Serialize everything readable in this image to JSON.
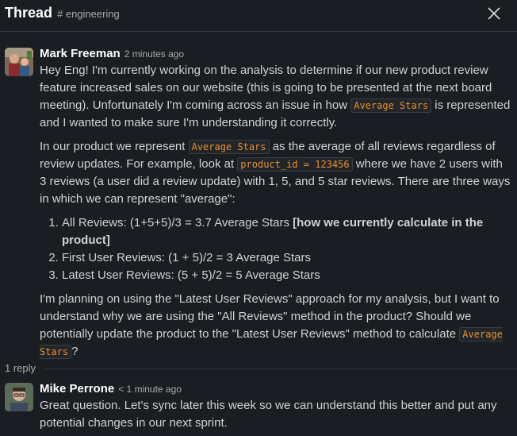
{
  "header": {
    "title": "Thread",
    "channel": "# engineering",
    "close_icon": "close-icon"
  },
  "message1": {
    "author": "Mark Freeman",
    "timestamp": "2 minutes ago",
    "p1_a": "Hey Eng! I'm currently working on the analysis to determine if our new product review feature increased sales on our website (this is going to be presented at the next board meeting). Unfortunately I'm coming across an issue in how ",
    "p1_code": "Average Stars",
    "p1_b": " is represented and I wanted to make sure I'm understanding it correctly.",
    "p2_a": "In our product we represent ",
    "p2_code1": "Average Stars",
    "p2_b": " as the average of all reviews regardless of review updates. For example, look at ",
    "p2_code2": "product_id =  123456",
    "p2_c": " where we have 2 users with 3 reviews (a user did a review update) with 1, 5, and 5 star reviews. There are three ways in which we can represent \"average\":",
    "list": [
      {
        "text": "All Reviews: (1+5+5)/3 = 3.7 Average Stars ",
        "bold": "[how we currently calculate in the product]"
      },
      {
        "text": "First User Reviews: (1 + 5)/2 = 3 Average Stars",
        "bold": ""
      },
      {
        "text": "Latest User Reviews: (5 + 5)/2 = 5 Average Stars",
        "bold": ""
      }
    ],
    "p3_a": "I'm planning on using the \"Latest User Reviews\" approach for my analysis, but I want to understand why we are using the \"All Reviews\" method in the product? Should we potentially update the product to the \"Latest User Reviews\" method to calculate ",
    "p3_code": "Average Stars",
    "p3_b": "?"
  },
  "replies": {
    "count_label": "1 reply"
  },
  "message2": {
    "author": "Mike Perrone",
    "timestamp": "< 1 minute ago",
    "text": "Great question. Let's sync later this week so we can understand this better and put any potential changes in our next sprint."
  },
  "colors": {
    "background": "#1a1d21",
    "code_text": "#e8912d",
    "author_text": "#ffffff",
    "body_text": "#d1d2d3",
    "muted_text": "#ababad"
  }
}
